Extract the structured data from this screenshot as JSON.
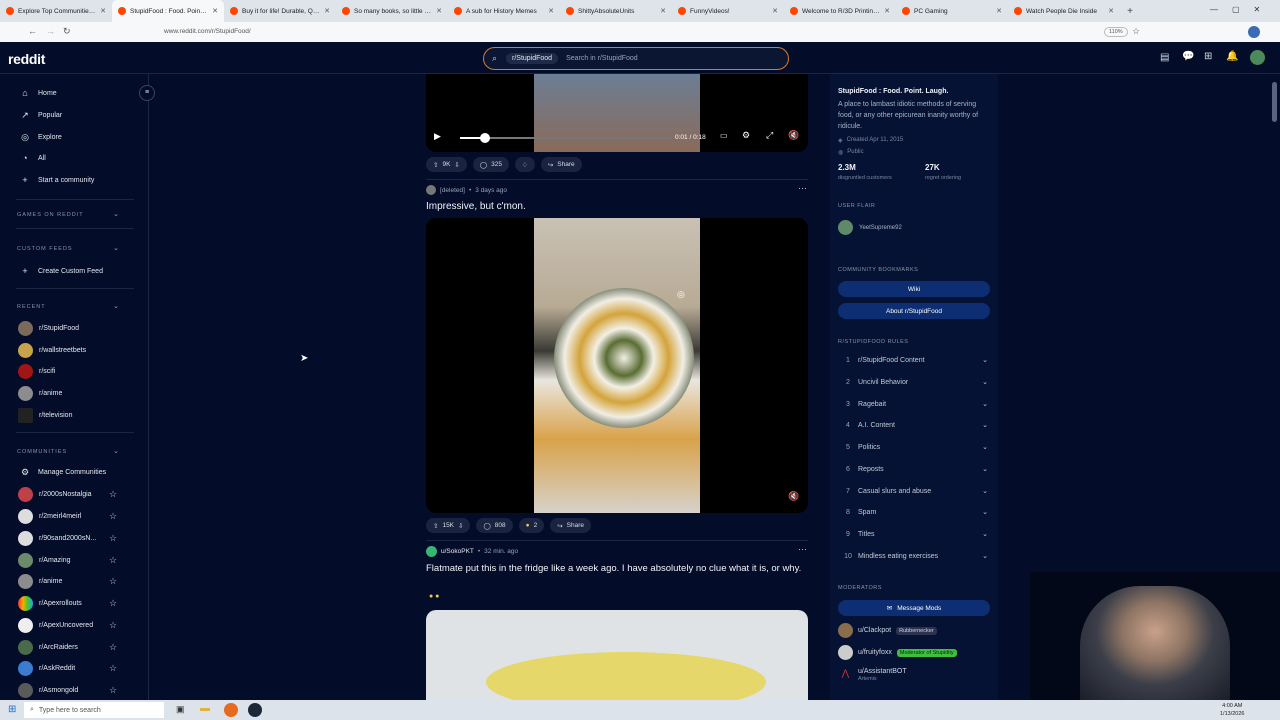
{
  "browser": {
    "tabs": [
      {
        "title": "Explore Top Communities on R"
      },
      {
        "title": "StupidFood : Food. Point. Laugh."
      },
      {
        "title": "Buy it for life! Durable, Quality, I"
      },
      {
        "title": "So many books, so little time"
      },
      {
        "title": "A sub for History Memes"
      },
      {
        "title": "ShittyAbsoluteUnits"
      },
      {
        "title": "FunnyVideos!"
      },
      {
        "title": "Welcome to R/3D Printing! Con"
      },
      {
        "title": "PC Gaming"
      },
      {
        "title": "Watch People Die Inside"
      }
    ],
    "url": "www.reddit.com/r/StupidFood/",
    "zoom": "110%"
  },
  "header": {
    "logo": "reddit",
    "search_chip": "r/StupidFood",
    "search_placeholder": "Search in r/StupidFood"
  },
  "sidebar": {
    "nav": [
      "Home",
      "Popular",
      "Explore",
      "All",
      "Start a community"
    ],
    "games_label": "GAMES ON REDDIT",
    "custom_feeds_label": "CUSTOM FEEDS",
    "create_feed": "Create Custom Feed",
    "recent_label": "RECENT",
    "recent": [
      "r/StupidFood",
      "r/wallstreetbets",
      "r/scifi",
      "r/anime",
      "r/television"
    ],
    "communities_label": "COMMUNITIES",
    "manage": "Manage Communities",
    "communities": [
      "r/2000sNostalgia",
      "r/2meirl4meirl",
      "r/90sand2000sN...",
      "r/Amazing",
      "r/anime",
      "r/Apexrollouts",
      "r/ApexUncovered",
      "r/ArcRaiders",
      "r/AskReddit",
      "r/Asmongold"
    ]
  },
  "feed": {
    "post0": {
      "time": "0:01 / 0:18",
      "upvotes": "9K",
      "comments": "325",
      "share": "Share",
      "progress": 0.12
    },
    "post1": {
      "user": "[deleted]",
      "age": "3 days ago",
      "title": "Impressive, but c'mon.",
      "upvotes": "15K",
      "comments": "808",
      "awards": "2",
      "share": "Share"
    },
    "post2": {
      "user": "u/SokoPKT",
      "age": "32 min. ago",
      "title": "Flatmate put this in the fridge like a week ago. I have absolutely no clue what it is, or why."
    }
  },
  "about": {
    "title": "StupidFood : Food. Point. Laugh.",
    "description": "A place to lambast idiotic methods of serving food, or any other epicurean inanity worthy of ridicule.",
    "created": "Created Apr 11, 2015",
    "visibility": "Public",
    "members": "2.3M",
    "members_label": "disgruntled customers",
    "online": "27K",
    "online_label": "regret ordering",
    "user_flair_label": "USER FLAIR",
    "user_flair_name": "YeetSupreme92",
    "bookmarks_label": "COMMUNITY BOOKMARKS",
    "wiki": "Wiki",
    "about_link": "About r/StupidFood",
    "rules_label": "R/STUPIDFOOD RULES",
    "rules": [
      {
        "n": "1",
        "t": "r/StupidFood Content"
      },
      {
        "n": "2",
        "t": "Uncivil Behavior"
      },
      {
        "n": "3",
        "t": "Ragebait"
      },
      {
        "n": "4",
        "t": "A.I. Content"
      },
      {
        "n": "5",
        "t": "Politics"
      },
      {
        "n": "6",
        "t": "Reposts"
      },
      {
        "n": "7",
        "t": "Casual slurs and abuse"
      },
      {
        "n": "8",
        "t": "Spam"
      },
      {
        "n": "9",
        "t": "Titles"
      },
      {
        "n": "10",
        "t": "Mindless eating exercises"
      }
    ],
    "moderators_label": "MODERATORS",
    "message_mods": "Message Mods",
    "mods": [
      {
        "name": "u/Clackpot",
        "flair": "Rubbernecker"
      },
      {
        "name": "u/fruityfoxx",
        "flair": "Moderator of Stupidity"
      },
      {
        "name": "u/AssistantBOT",
        "flair": "Artemis"
      }
    ]
  },
  "taskbar": {
    "search": "Type here to search",
    "time": "4:00 AM",
    "date": "1/13/2026"
  },
  "colors": {
    "accent": "#d97a2b",
    "bg": "#030d2a",
    "button": "#0d2e73",
    "green_flair": "#3fbf3f"
  }
}
